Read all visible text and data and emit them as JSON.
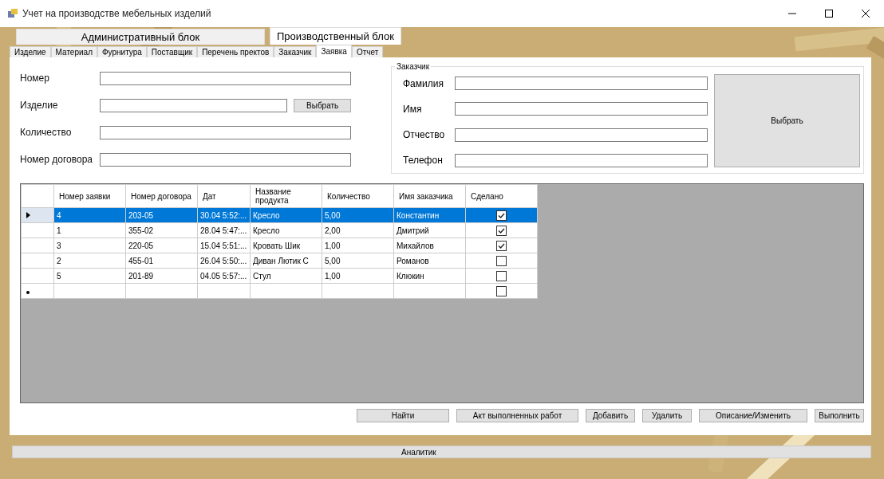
{
  "window": {
    "title": "Учет на производстве мебельных изделий"
  },
  "top_tabs": [
    {
      "label": "Административный блок",
      "selected": false
    },
    {
      "label": "Производственный блок",
      "selected": true
    }
  ],
  "tabs": [
    {
      "label": "Изделие",
      "selected": false
    },
    {
      "label": "Материал",
      "selected": false
    },
    {
      "label": "Фурнитура",
      "selected": false
    },
    {
      "label": "Поставщик",
      "selected": false
    },
    {
      "label": "Перечень пректов",
      "selected": false
    },
    {
      "label": "Заказчик",
      "selected": false
    },
    {
      "label": "Заявка",
      "selected": true
    },
    {
      "label": "Отчет",
      "selected": false
    }
  ],
  "order_form": {
    "fields": [
      {
        "label": "Номер"
      },
      {
        "label": "Изделие",
        "button": "Выбрать"
      },
      {
        "label": "Количество"
      },
      {
        "label": "Номер договора"
      }
    ]
  },
  "customer": {
    "title": "Заказчик",
    "fields": [
      {
        "label": "Фамилия"
      },
      {
        "label": "Имя"
      },
      {
        "label": "Отчество"
      },
      {
        "label": "Телефон"
      }
    ],
    "select_button": "Выбрать"
  },
  "table": {
    "columns": [
      "Номер заявки",
      "Номер договора",
      "Дат",
      "Название продукта",
      "Количество",
      "Имя заказчика",
      "Сделано"
    ],
    "rows": [
      {
        "selected": true,
        "cells": [
          "4",
          "203-05",
          "30.04 5:52:...",
          "Кресло",
          "5,00",
          "Константин"
        ],
        "done": true
      },
      {
        "selected": false,
        "cells": [
          "1",
          "355-02",
          "28.04 5:47:...",
          "Кресло",
          "2,00",
          "Дмитрий"
        ],
        "done": true
      },
      {
        "selected": false,
        "cells": [
          "3",
          "220-05",
          "15.04 5:51:...",
          "Кровать Шик",
          "1,00",
          "Михайлов"
        ],
        "done": true
      },
      {
        "selected": false,
        "cells": [
          "2",
          "455-01",
          "26.04 5:50:...",
          "Диван Лютик С",
          "5,00",
          "Романов"
        ],
        "done": false
      },
      {
        "selected": false,
        "cells": [
          "5",
          "201-89",
          "04.05 5:57:...",
          "Стул",
          "1,00",
          "Клюкин"
        ],
        "done": false
      }
    ],
    "new_row": {
      "done": false
    }
  },
  "actions": [
    "Найти",
    "Акт выполненных работ",
    "Добавить",
    "Удалить",
    "Описание/Изменить",
    "Выполнить"
  ],
  "bottom_button": "Аналитик"
}
